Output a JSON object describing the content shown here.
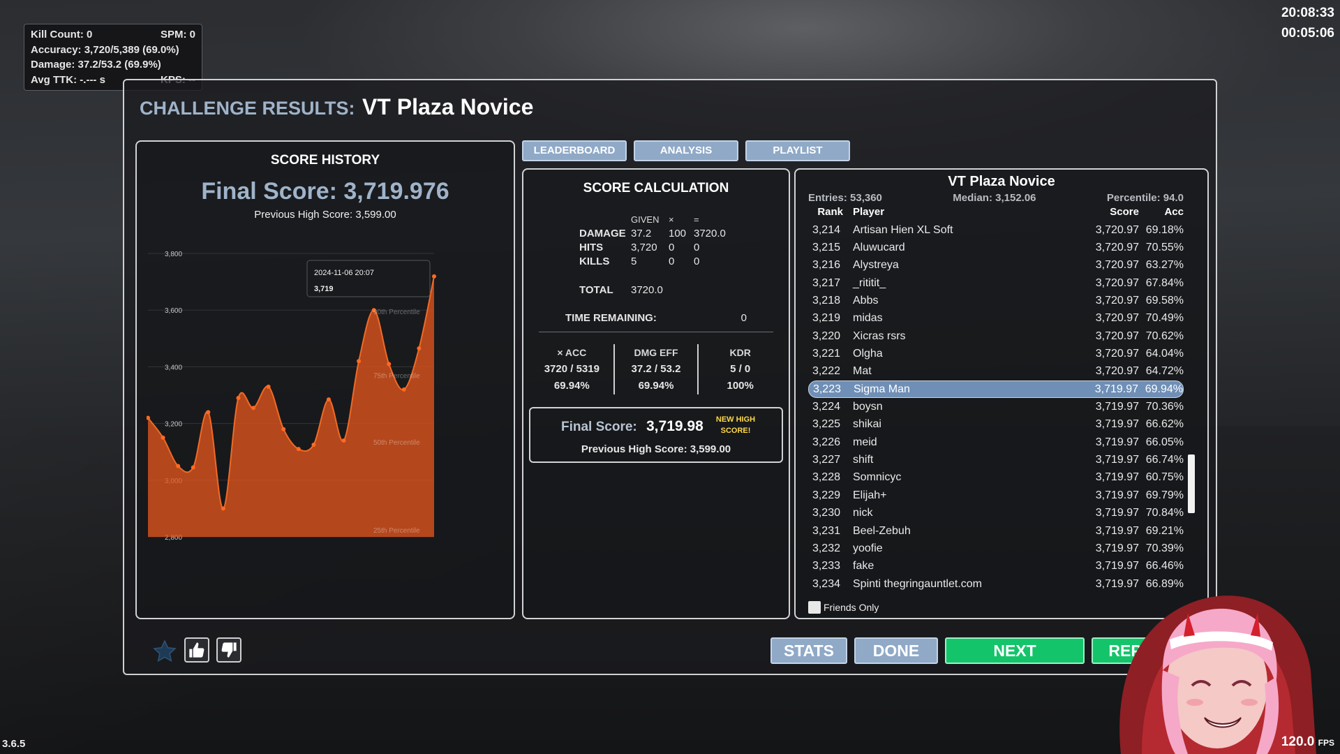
{
  "hud": {
    "kill_count_label": "Kill Count:",
    "kill_count": "0",
    "spm_label": "SPM:",
    "spm": "0",
    "accuracy_label": "Accuracy:",
    "accuracy": "3,720/5,389 (69.0%)",
    "damage_label": "Damage:",
    "damage": "37.2/53.2 (69.9%)",
    "ttk_label": "Avg TTK:",
    "ttk": "-.--- s",
    "kps_label": "KPS:",
    "kps": "--"
  },
  "clock": {
    "time": "20:08:33",
    "elapsed": "00:05:06"
  },
  "version": "3.6.5",
  "fps": {
    "value": "120.0",
    "unit": "FPS"
  },
  "title": {
    "prefix": "CHALLENGE RESULTS:",
    "scenario": "VT Plaza Novice"
  },
  "tabs": [
    "LEADERBOARD",
    "ANALYSIS",
    "PLAYLIST"
  ],
  "history": {
    "title": "SCORE HISTORY",
    "final_score": "Final Score: 3,719.976",
    "previous_high": "Previous High Score: 3,599.00",
    "tooltip_date": "2024-11-06 20:07",
    "tooltip_value": "3,719"
  },
  "chart_data": {
    "type": "area",
    "title": "SCORE HISTORY",
    "ylim": [
      2800,
      3800
    ],
    "yticks": [
      "3,800",
      "3,600",
      "3,400",
      "3,200",
      "3,000",
      "2,800"
    ],
    "ytick_values": [
      3800,
      3600,
      3400,
      3200,
      3000,
      2800
    ],
    "values": [
      3220,
      3150,
      3050,
      3045,
      3240,
      2900,
      3290,
      3255,
      3330,
      3180,
      3110,
      3125,
      3285,
      3140,
      3420,
      3600,
      3410,
      3320,
      3465,
      3719
    ],
    "percentile_lines": [
      {
        "label": "25th Percentile",
        "value": 2825
      },
      {
        "label": "50th Percentile",
        "value": 3135
      },
      {
        "label": "75th Percentile",
        "value": 3370
      },
      {
        "label": "90th Percentile",
        "value": 3595
      }
    ],
    "color": "#e0551c"
  },
  "calc": {
    "title": "SCORE CALCULATION",
    "headers": [
      "GIVEN",
      "×",
      "="
    ],
    "rows": [
      {
        "label": "DAMAGE",
        "given": "37.2",
        "mult": "100",
        "result": "3720.0"
      },
      {
        "label": "HITS",
        "given": "3,720",
        "mult": "0",
        "result": "0"
      },
      {
        "label": "KILLS",
        "given": "5",
        "mult": "0",
        "result": "0"
      }
    ],
    "total_label": "TOTAL",
    "total": "3720.0",
    "time_label": "TIME REMAINING:",
    "time": "0",
    "metrics": [
      {
        "label": "× ACC",
        "value": "3720 / 5319",
        "pct": "69.94%"
      },
      {
        "label": "DMG EFF",
        "value": "37.2 / 53.2",
        "pct": "69.94%"
      },
      {
        "label": "KDR",
        "value": "5 / 0",
        "pct": "100%"
      }
    ],
    "final_label": "Final Score:",
    "final_value": "3,719.98",
    "new_high": "NEW HIGH SCORE!",
    "previous_high": "Previous High Score: 3,599.00"
  },
  "board": {
    "title": "VT Plaza Novice",
    "entries": "Entries: 53,360",
    "median": "Median: 3,152.06",
    "percentile": "Percentile: 94.0",
    "columns": [
      "Rank",
      "Player",
      "Score",
      "Acc"
    ],
    "rows": [
      {
        "rank": "3,214",
        "player": "Artisan Hien XL Soft",
        "score": "3,720.97",
        "acc": "69.18%"
      },
      {
        "rank": "3,215",
        "player": "Aluwucard",
        "score": "3,720.97",
        "acc": "70.55%"
      },
      {
        "rank": "3,216",
        "player": "Alystreya",
        "score": "3,720.97",
        "acc": "63.27%"
      },
      {
        "rank": "3,217",
        "player": "_rititit_",
        "score": "3,720.97",
        "acc": "67.84%"
      },
      {
        "rank": "3,218",
        "player": "Abbs",
        "score": "3,720.97",
        "acc": "69.58%"
      },
      {
        "rank": "3,219",
        "player": "midas",
        "score": "3,720.97",
        "acc": "70.49%"
      },
      {
        "rank": "3,220",
        "player": "Xicras rsrs",
        "score": "3,720.97",
        "acc": "70.62%"
      },
      {
        "rank": "3,221",
        "player": "Olgha",
        "score": "3,720.97",
        "acc": "64.04%"
      },
      {
        "rank": "3,222",
        "player": "Mat",
        "score": "3,720.97",
        "acc": "64.72%"
      },
      {
        "rank": "3,223",
        "player": "Sigma Man",
        "score": "3,719.97",
        "acc": "69.94%"
      },
      {
        "rank": "3,224",
        "player": "boysn",
        "score": "3,719.97",
        "acc": "70.36%"
      },
      {
        "rank": "3,225",
        "player": "shikai",
        "score": "3,719.97",
        "acc": "66.62%"
      },
      {
        "rank": "3,226",
        "player": "meid",
        "score": "3,719.97",
        "acc": "66.05%"
      },
      {
        "rank": "3,227",
        "player": "shift",
        "score": "3,719.97",
        "acc": "66.74%"
      },
      {
        "rank": "3,228",
        "player": "Somnicyc",
        "score": "3,719.97",
        "acc": "60.75%"
      },
      {
        "rank": "3,229",
        "player": "Elijah+",
        "score": "3,719.97",
        "acc": "69.79%"
      },
      {
        "rank": "3,230",
        "player": "nick",
        "score": "3,719.97",
        "acc": "70.84%"
      },
      {
        "rank": "3,231",
        "player": "Beel-Zebuh",
        "score": "3,719.97",
        "acc": "69.21%"
      },
      {
        "rank": "3,232",
        "player": "yoofie",
        "score": "3,719.97",
        "acc": "70.39%"
      },
      {
        "rank": "3,233",
        "player": "fake",
        "score": "3,719.97",
        "acc": "66.46%"
      },
      {
        "rank": "3,234",
        "player": "Spinti thegringauntlet.com",
        "score": "3,719.97",
        "acc": "66.89%"
      }
    ],
    "highlight_rank": "3,223",
    "friends_only": "Friends Only"
  },
  "buttons": {
    "stats": "STATS",
    "done": "DONE",
    "next": "NEXT",
    "replay": "REPLAY"
  },
  "icons": {
    "favorite": "star-icon",
    "like": "thumbs-up-icon",
    "dislike": "thumbs-down-icon"
  }
}
